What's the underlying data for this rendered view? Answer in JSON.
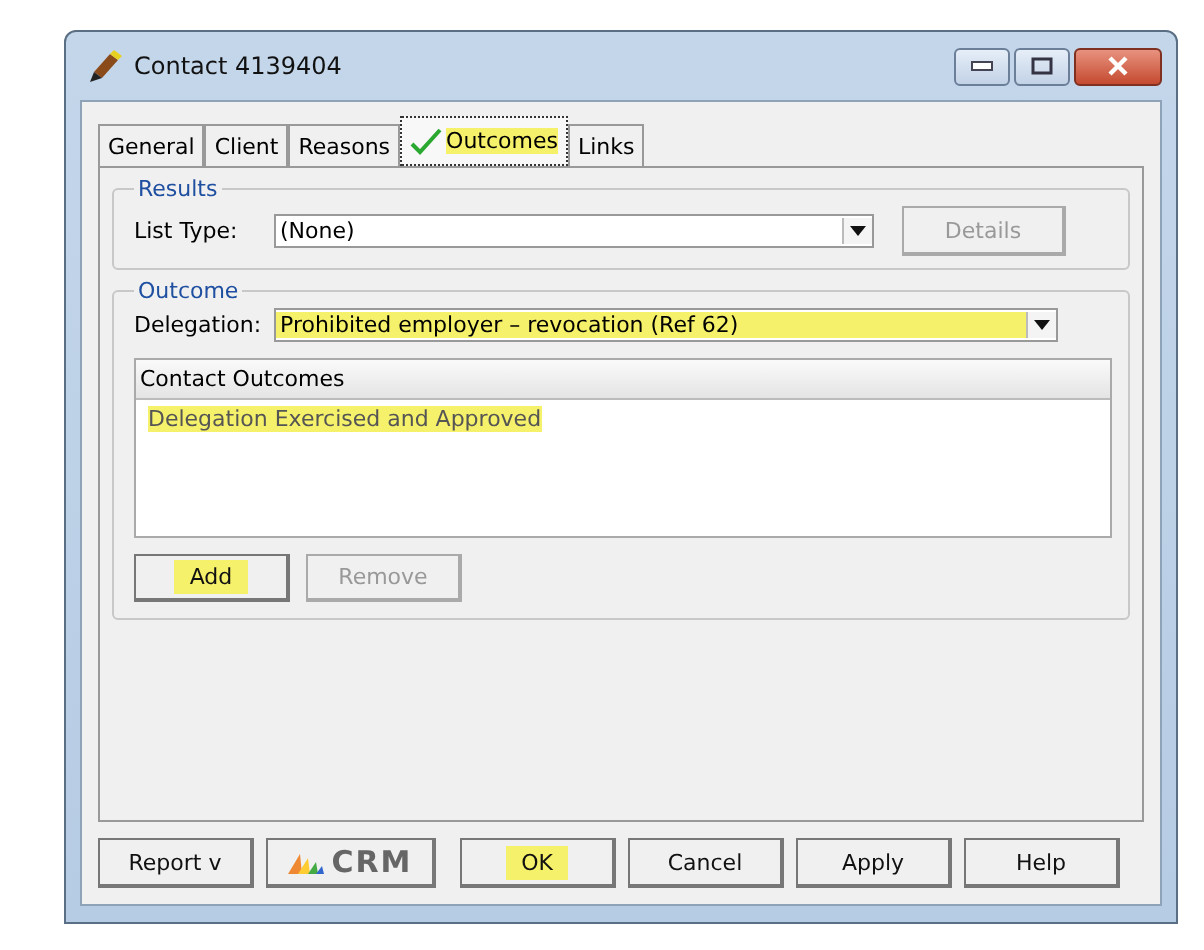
{
  "window": {
    "title": "Contact 4139404"
  },
  "tabs": [
    {
      "label": "General",
      "selected": false,
      "checked": false,
      "highlighted": false
    },
    {
      "label": "Client",
      "selected": false,
      "checked": false,
      "highlighted": false
    },
    {
      "label": "Reasons",
      "selected": false,
      "checked": false,
      "highlighted": false
    },
    {
      "label": "Outcomes",
      "selected": true,
      "checked": true,
      "highlighted": true
    },
    {
      "label": "Links",
      "selected": false,
      "checked": false,
      "highlighted": false
    }
  ],
  "results": {
    "title": "Results",
    "list_type_label": "List Type:",
    "list_type_value": "(None)",
    "details_button": {
      "label": "Details",
      "disabled": true
    }
  },
  "outcome": {
    "title": "Outcome",
    "delegation_label": "Delegation:",
    "delegation_value": "Prohibited employer – revocation (Ref 62)",
    "delegation_highlighted": true,
    "list": {
      "header": "Contact Outcomes",
      "rows": [
        {
          "text": "Delegation Exercised and Approved",
          "highlighted": true
        }
      ]
    },
    "buttons": [
      {
        "label": "Add",
        "disabled": false,
        "highlighted": true
      },
      {
        "label": "Remove",
        "disabled": true,
        "highlighted": false
      }
    ]
  },
  "footer_buttons": [
    {
      "kind": "text",
      "label": "Report v",
      "highlighted": false
    },
    {
      "kind": "logo",
      "label": "CRM",
      "highlighted": false
    },
    {
      "kind": "spacer"
    },
    {
      "kind": "text",
      "label": "OK",
      "highlighted": true
    },
    {
      "kind": "text",
      "label": "Cancel",
      "highlighted": false
    },
    {
      "kind": "text",
      "label": "Apply",
      "highlighted": false
    },
    {
      "kind": "text",
      "label": "Help",
      "highlighted": false
    }
  ]
}
